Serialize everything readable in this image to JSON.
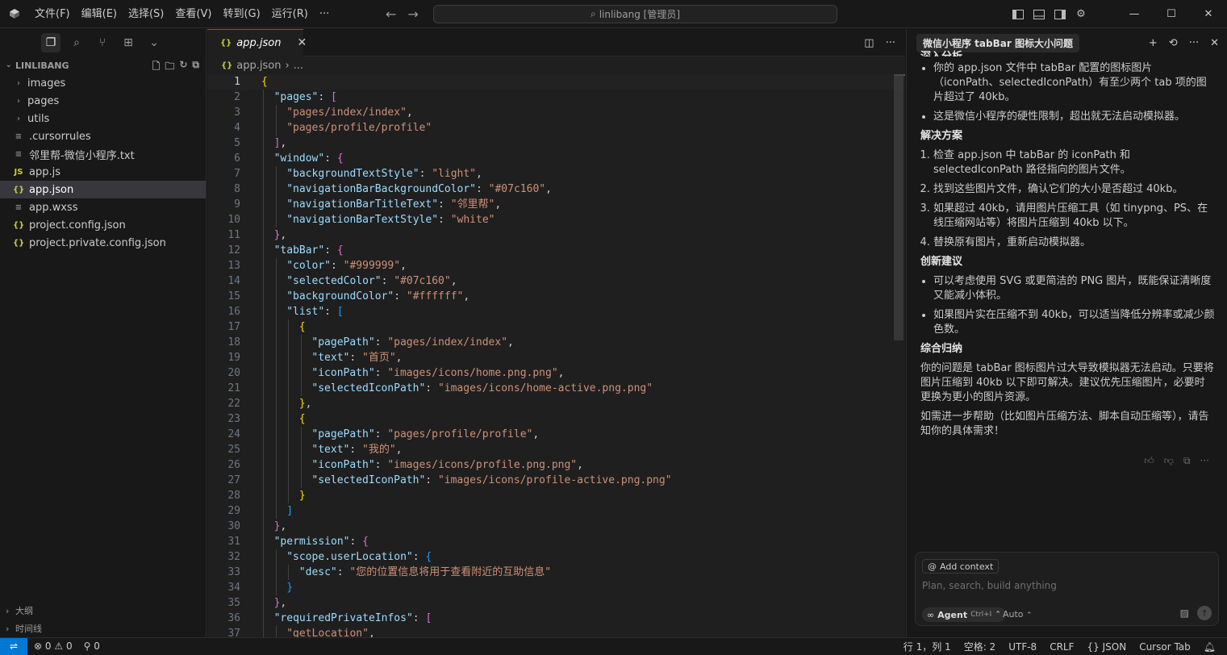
{
  "titlebar": {
    "menu": [
      "文件(F)",
      "编辑(E)",
      "选择(S)",
      "查看(V)",
      "转到(G)",
      "运行(R)",
      "···"
    ],
    "search": "linlibang [管理员]"
  },
  "sidebar": {
    "header": "LINLIBANG",
    "items": [
      {
        "label": "images",
        "type": "folder"
      },
      {
        "label": "pages",
        "type": "folder"
      },
      {
        "label": "utils",
        "type": "folder"
      },
      {
        "label": ".cursorrules",
        "type": "file",
        "icon": "≡"
      },
      {
        "label": "邻里帮-微信小程序.txt",
        "type": "file",
        "icon": "≡"
      },
      {
        "label": "app.js",
        "type": "file",
        "icon": "JS"
      },
      {
        "label": "app.json",
        "type": "file",
        "icon": "{}"
      },
      {
        "label": "app.wxss",
        "type": "file",
        "icon": "≡"
      },
      {
        "label": "project.config.json",
        "type": "file",
        "icon": "{}"
      },
      {
        "label": "project.private.config.json",
        "type": "file",
        "icon": "{}"
      }
    ],
    "outline": "大纲",
    "timeline": "时间线"
  },
  "editor": {
    "tab": "app.json",
    "breadcrumb": [
      "app.json",
      "..."
    ],
    "current_line": 1
  },
  "chat": {
    "title": "微信小程序 tabBar 图标大小问题",
    "sec0_title": "深入分析",
    "sec0_items": [
      "你的 app.json 文件中 tabBar 配置的图标图片（iconPath、selectedIconPath）有至少两个 tab 项的图片超过了 40kb。",
      "这是微信小程序的硬性限制，超出就无法启动模拟器。"
    ],
    "sec1_title": "解决方案",
    "sec1_items": [
      "检查 app.json 中 tabBar 的 iconPath 和 selectedIconPath 路径指向的图片文件。",
      "找到这些图片文件，确认它们的大小是否超过 40kb。",
      "如果超过 40kb，请用图片压缩工具（如 tinypng、PS、在线压缩网站等）将图片压缩到 40kb 以下。",
      "替换原有图片，重新启动模拟器。"
    ],
    "sec2_title": "创新建议",
    "sec2_items": [
      "可以考虑使用 SVG 或更简洁的 PNG 图片，既能保证清晰度又能减小体积。",
      "如果图片实在压缩不到 40kb，可以适当降低分辨率或减少颜色数。"
    ],
    "sec3_title": "综合归纳",
    "summary": "你的问题是 tabBar 图标图片过大导致模拟器无法启动。只要将图片压缩到 40kb 以下即可解决。建议优先压缩图片，必要时更换为更小的图片资源。",
    "followup": "如需进一步帮助（比如图片压缩方法、脚本自动压缩等），请告知你的具体需求！",
    "add_context": "Add context",
    "placeholder": "Plan, search, build anything",
    "agent_label": "Agent",
    "agent_kbd": "Ctrl+I",
    "model": "Auto"
  },
  "status": {
    "errors": "0",
    "warnings": "0",
    "ports": "0",
    "position": "行 1，列 1",
    "spaces": "空格: 2",
    "encoding": "UTF-8",
    "eol": "CRLF",
    "language": "JSON",
    "ext": "Cursor Tab"
  },
  "code": [
    [
      1,
      0,
      [
        [
          "b1",
          "{"
        ]
      ]
    ],
    [
      2,
      1,
      [
        [
          "k",
          "\"pages\""
        ],
        [
          "p",
          ": "
        ],
        [
          "b2",
          "["
        ]
      ]
    ],
    [
      3,
      2,
      [
        [
          "s",
          "\"pages/index/index\""
        ],
        [
          "p",
          ","
        ]
      ]
    ],
    [
      4,
      2,
      [
        [
          "s",
          "\"pages/profile/profile\""
        ]
      ]
    ],
    [
      5,
      1,
      [
        [
          "b2",
          "]"
        ],
        [
          "p",
          ","
        ]
      ]
    ],
    [
      6,
      1,
      [
        [
          "k",
          "\"window\""
        ],
        [
          "p",
          ": "
        ],
        [
          "b2",
          "{"
        ]
      ]
    ],
    [
      7,
      2,
      [
        [
          "k",
          "\"backgroundTextStyle\""
        ],
        [
          "p",
          ": "
        ],
        [
          "s",
          "\"light\""
        ],
        [
          "p",
          ","
        ]
      ]
    ],
    [
      8,
      2,
      [
        [
          "k",
          "\"navigationBarBackgroundColor\""
        ],
        [
          "p",
          ": "
        ],
        [
          "s",
          "\"#07c160\""
        ],
        [
          "p",
          ","
        ]
      ]
    ],
    [
      9,
      2,
      [
        [
          "k",
          "\"navigationBarTitleText\""
        ],
        [
          "p",
          ": "
        ],
        [
          "s",
          "\"邻里帮\""
        ],
        [
          "p",
          ","
        ]
      ]
    ],
    [
      10,
      2,
      [
        [
          "k",
          "\"navigationBarTextStyle\""
        ],
        [
          "p",
          ": "
        ],
        [
          "s",
          "\"white\""
        ]
      ]
    ],
    [
      11,
      1,
      [
        [
          "b2",
          "}"
        ],
        [
          "p",
          ","
        ]
      ]
    ],
    [
      12,
      1,
      [
        [
          "k",
          "\"tabBar\""
        ],
        [
          "p",
          ": "
        ],
        [
          "b2",
          "{"
        ]
      ]
    ],
    [
      13,
      2,
      [
        [
          "k",
          "\"color\""
        ],
        [
          "p",
          ": "
        ],
        [
          "s",
          "\"#999999\""
        ],
        [
          "p",
          ","
        ]
      ]
    ],
    [
      14,
      2,
      [
        [
          "k",
          "\"selectedColor\""
        ],
        [
          "p",
          ": "
        ],
        [
          "s",
          "\"#07c160\""
        ],
        [
          "p",
          ","
        ]
      ]
    ],
    [
      15,
      2,
      [
        [
          "k",
          "\"backgroundColor\""
        ],
        [
          "p",
          ": "
        ],
        [
          "s",
          "\"#ffffff\""
        ],
        [
          "p",
          ","
        ]
      ]
    ],
    [
      16,
      2,
      [
        [
          "k",
          "\"list\""
        ],
        [
          "p",
          ": "
        ],
        [
          "b3",
          "["
        ]
      ]
    ],
    [
      17,
      3,
      [
        [
          "b1",
          "{"
        ]
      ]
    ],
    [
      18,
      4,
      [
        [
          "k",
          "\"pagePath\""
        ],
        [
          "p",
          ": "
        ],
        [
          "s",
          "\"pages/index/index\""
        ],
        [
          "p",
          ","
        ]
      ]
    ],
    [
      19,
      4,
      [
        [
          "k",
          "\"text\""
        ],
        [
          "p",
          ": "
        ],
        [
          "s",
          "\"首页\""
        ],
        [
          "p",
          ","
        ]
      ]
    ],
    [
      20,
      4,
      [
        [
          "k",
          "\"iconPath\""
        ],
        [
          "p",
          ": "
        ],
        [
          "s",
          "\"images/icons/home.png.png\""
        ],
        [
          "p",
          ","
        ]
      ]
    ],
    [
      21,
      4,
      [
        [
          "k",
          "\"selectedIconPath\""
        ],
        [
          "p",
          ": "
        ],
        [
          "s",
          "\"images/icons/home-active.png.png\""
        ]
      ]
    ],
    [
      22,
      3,
      [
        [
          "b1",
          "}"
        ],
        [
          "p",
          ","
        ]
      ]
    ],
    [
      23,
      3,
      [
        [
          "b1",
          "{"
        ]
      ]
    ],
    [
      24,
      4,
      [
        [
          "k",
          "\"pagePath\""
        ],
        [
          "p",
          ": "
        ],
        [
          "s",
          "\"pages/profile/profile\""
        ],
        [
          "p",
          ","
        ]
      ]
    ],
    [
      25,
      4,
      [
        [
          "k",
          "\"text\""
        ],
        [
          "p",
          ": "
        ],
        [
          "s",
          "\"我的\""
        ],
        [
          "p",
          ","
        ]
      ]
    ],
    [
      26,
      4,
      [
        [
          "k",
          "\"iconPath\""
        ],
        [
          "p",
          ": "
        ],
        [
          "s",
          "\"images/icons/profile.png.png\""
        ],
        [
          "p",
          ","
        ]
      ]
    ],
    [
      27,
      4,
      [
        [
          "k",
          "\"selectedIconPath\""
        ],
        [
          "p",
          ": "
        ],
        [
          "s",
          "\"images/icons/profile-active.png.png\""
        ]
      ]
    ],
    [
      28,
      3,
      [
        [
          "b1",
          "}"
        ]
      ]
    ],
    [
      29,
      2,
      [
        [
          "b3",
          "]"
        ]
      ]
    ],
    [
      30,
      1,
      [
        [
          "b2",
          "}"
        ],
        [
          "p",
          ","
        ]
      ]
    ],
    [
      31,
      1,
      [
        [
          "k",
          "\"permission\""
        ],
        [
          "p",
          ": "
        ],
        [
          "b2",
          "{"
        ]
      ]
    ],
    [
      32,
      2,
      [
        [
          "k",
          "\"scope.userLocation\""
        ],
        [
          "p",
          ": "
        ],
        [
          "b3",
          "{"
        ]
      ]
    ],
    [
      33,
      3,
      [
        [
          "k",
          "\"desc\""
        ],
        [
          "p",
          ": "
        ],
        [
          "s",
          "\"您的位置信息将用于查看附近的互助信息\""
        ]
      ]
    ],
    [
      34,
      2,
      [
        [
          "b3",
          "}"
        ]
      ]
    ],
    [
      35,
      1,
      [
        [
          "b2",
          "}"
        ],
        [
          "p",
          ","
        ]
      ]
    ],
    [
      36,
      1,
      [
        [
          "k",
          "\"requiredPrivateInfos\""
        ],
        [
          "p",
          ": "
        ],
        [
          "b2",
          "["
        ]
      ]
    ],
    [
      37,
      2,
      [
        [
          "s",
          "\"getLocation\""
        ],
        [
          "p",
          ","
        ]
      ]
    ]
  ]
}
